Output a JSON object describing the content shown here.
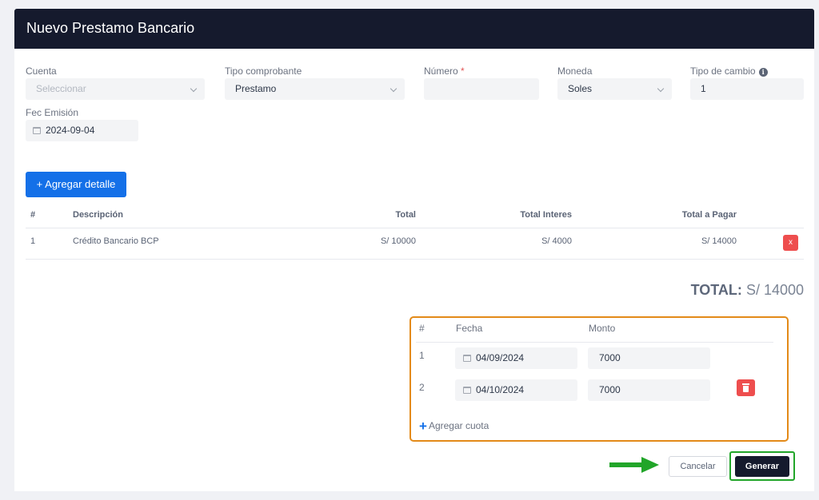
{
  "modal": {
    "title": "Nuevo Prestamo Bancario"
  },
  "form": {
    "cuenta": {
      "label": "Cuenta",
      "placeholder": "Seleccionar"
    },
    "tipo_comprobante": {
      "label": "Tipo comprobante",
      "value": "Prestamo"
    },
    "numero": {
      "label": "Número",
      "required_mark": "*",
      "value": ""
    },
    "moneda": {
      "label": "Moneda",
      "value": "Soles"
    },
    "tipo_cambio": {
      "label": "Tipo de cambio",
      "info_icon": "i",
      "value": "1"
    },
    "fec_emision": {
      "label": "Fec Emisión",
      "value": "2024-09-04"
    }
  },
  "add_detail_button": "+ Agregar detalle",
  "detail_table": {
    "headers": [
      "#",
      "Descripción",
      "Total",
      "Total Interes",
      "Total a Pagar"
    ],
    "rows": [
      {
        "index": "1",
        "descripcion": "Crédito Bancario BCP",
        "total": "S/ 10000",
        "total_interes": "S/ 4000",
        "total_pagar": "S/ 14000",
        "delete_label": "x"
      }
    ]
  },
  "total": {
    "label": "TOTAL:",
    "value": "S/ 14000"
  },
  "cuotas": {
    "headers": [
      "#",
      "Fecha",
      "Monto"
    ],
    "rows": [
      {
        "index": "1",
        "fecha": "04/09/2024",
        "monto": "7000"
      },
      {
        "index": "2",
        "fecha": "04/10/2024",
        "monto": "7000"
      }
    ],
    "add_label": "Agregar cuota",
    "add_icon": "+"
  },
  "footer": {
    "cancel_label": "Cancelar",
    "generate_label": "Generar"
  },
  "colors": {
    "header_bg": "#151a2d",
    "primary": "#1470e8",
    "danger": "#ee4e4e",
    "highlight_orange": "#e38a18",
    "highlight_green": "#21a529"
  }
}
